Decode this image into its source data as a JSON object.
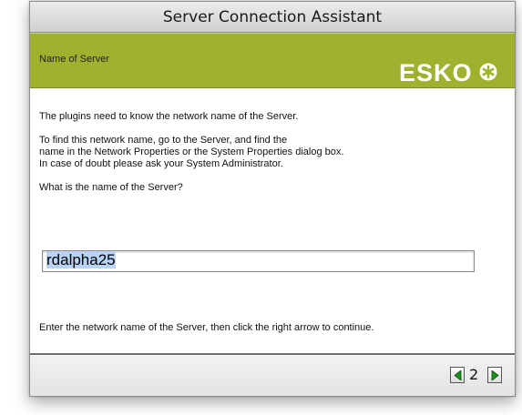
{
  "window": {
    "title": "Server Connection Assistant"
  },
  "banner": {
    "label": "Name of Server",
    "logo_text": "ESKO",
    "brand_color": "#9fb12f",
    "logo_color": "#ffffff"
  },
  "content": {
    "intro": "The plugins need to know the network name of the Server.",
    "instructions_line1": "To find this network name, go to the Server, and find the",
    "instructions_line2": "name in the Network Properties or the System Properties dialog box.",
    "instructions_line3": "In case of doubt please ask your System Administrator.",
    "question": "What is the name of the Server?",
    "server_name_value": "rdalpha25",
    "hint": "Enter the network name of the Server, then click the right arrow to continue."
  },
  "footer": {
    "page_number": "2",
    "prev_icon": "triangle-left-icon",
    "next_icon": "triangle-right-icon"
  }
}
